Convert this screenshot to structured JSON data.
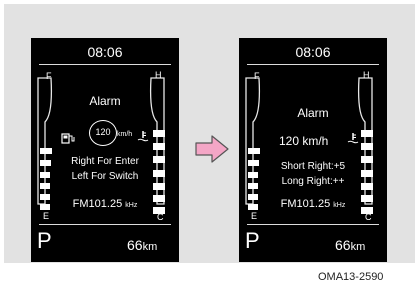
{
  "left_screen": {
    "time": "08:06",
    "fuel_full_label": "F",
    "fuel_empty_label": "E",
    "temp_hot_label": "H",
    "temp_cold_label": "C",
    "alarm_title": "Alarm",
    "speed_value": "120",
    "speed_unit": "km/h",
    "instruction_line1": "Right For Enter",
    "instruction_line2": "Left For Switch",
    "radio_station": "FM101.25",
    "radio_unit": "kHz",
    "gear": "P",
    "range_value": "66",
    "range_unit": "km",
    "fuel_icon": "fuel-pump-icon",
    "temp_icon": "coolant-temp-icon"
  },
  "right_screen": {
    "time": "08:06",
    "fuel_full_label": "F",
    "fuel_empty_label": "E",
    "temp_hot_label": "H",
    "temp_cold_label": "C",
    "alarm_title": "Alarm",
    "speed_setting": "120 km/h",
    "instruction_line1": "Short Right:+5",
    "instruction_line2": "Long Right:++",
    "radio_station": "FM101.25",
    "radio_unit": "kHz",
    "gear": "P",
    "range_value": "66",
    "range_unit": "km",
    "temp_icon": "coolant-temp-icon"
  },
  "transition_arrow": {
    "icon": "right-arrow-icon",
    "color": "#f4a6c6"
  },
  "caption": "OMA13-2590",
  "colors": {
    "background": "#e2e2e2",
    "screen": "#000000",
    "text": "#ffffff"
  }
}
